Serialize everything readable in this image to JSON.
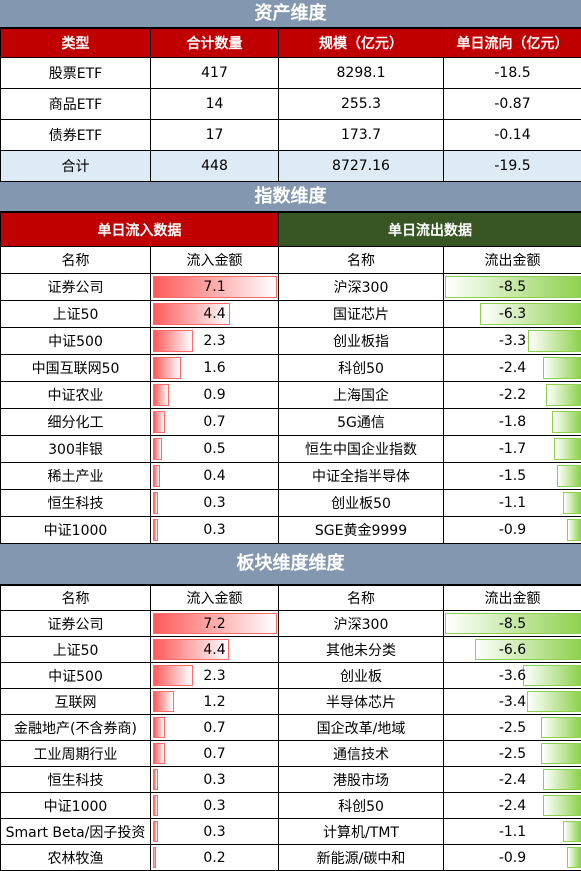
{
  "asset": {
    "title": "资产维度",
    "headers": [
      "类型",
      "合计数量",
      "规模（亿元）",
      "单日流向（亿元）"
    ],
    "rows": [
      [
        "股票ETF",
        "417",
        "8298.1",
        "-18.5"
      ],
      [
        "商品ETF",
        "14",
        "255.3",
        "-0.87"
      ],
      [
        "债券ETF",
        "17",
        "173.7",
        "-0.14"
      ]
    ],
    "total": [
      "合计",
      "448",
      "8727.16",
      "-19.5"
    ]
  },
  "index": {
    "title": "指数维度",
    "inflow_label": "单日流入数据",
    "outflow_label": "单日流出数据",
    "inflow_color": "#c00000",
    "outflow_color": "#375623",
    "headers": [
      "名称",
      "流入金额",
      "名称",
      "流出金额"
    ],
    "rows": [
      [
        "证券公司",
        7.1,
        "沪深300",
        -8.5
      ],
      [
        "上证50",
        4.4,
        "国证芯片",
        -6.3
      ],
      [
        "中证500",
        2.3,
        "创业板指",
        -3.3
      ],
      [
        "中国互联网50",
        1.6,
        "科创50",
        -2.4
      ],
      [
        "中证农业",
        0.9,
        "上海国企",
        -2.2
      ],
      [
        "细分化工",
        0.7,
        "5G通信",
        -1.8
      ],
      [
        "300非银",
        0.5,
        "恒生中国企业指数",
        -1.7
      ],
      [
        "稀土产业",
        0.4,
        "中证全指半导体",
        -1.5
      ],
      [
        "恒生科技",
        0.3,
        "创业板50",
        -1.1
      ],
      [
        "中证1000",
        0.3,
        "SGE黄金9999",
        -0.9
      ]
    ]
  },
  "sector": {
    "title": "板块维度维度",
    "headers": [
      "名称",
      "流入金额",
      "名称",
      "流出金额"
    ],
    "rows": [
      [
        "证券公司",
        7.2,
        "沪深300",
        -8.5
      ],
      [
        "上证50",
        4.4,
        "其他未分类",
        -6.6
      ],
      [
        "中证500",
        2.3,
        "创业板",
        -3.6
      ],
      [
        "互联网",
        1.2,
        "半导体芯片",
        -3.4
      ],
      [
        "金融地产(不含券商)",
        0.7,
        "国企改革/地域",
        -2.5
      ],
      [
        "工业周期行业",
        0.7,
        "通信技术",
        -2.5
      ],
      [
        "恒生科技",
        0.3,
        "港股市场",
        -2.4
      ],
      [
        "中证1000",
        0.3,
        "科创50",
        -2.4
      ],
      [
        "Smart Beta/因子投资",
        0.3,
        "计算机/TMT",
        -1.1
      ],
      [
        "农林牧渔",
        0.2,
        "新能源/碳中和",
        -0.9
      ]
    ]
  }
}
